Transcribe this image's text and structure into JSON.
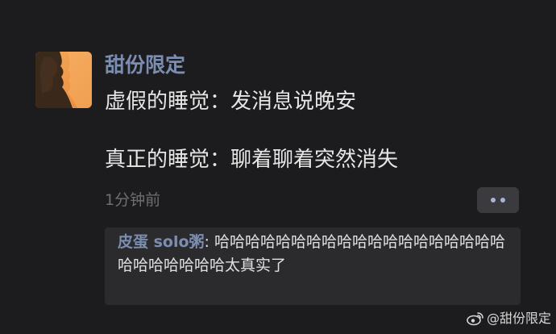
{
  "post": {
    "author": "甜份限定",
    "line1": "虚假的睡觉：发消息说晚安",
    "line2": "真正的睡觉：聊着聊着突然消失",
    "time": "1分钟前",
    "more_icon": "more-dots-icon"
  },
  "comments": [
    {
      "author": "皮蛋 solo粥",
      "separator": ": ",
      "text": "哈哈哈哈哈哈哈哈哈哈哈哈哈哈哈哈哈哈哈哈哈哈哈哈哈哈太真实了"
    }
  ],
  "watermark": {
    "text": "@甜份限定",
    "icon": "weibo-logo-icon"
  },
  "colors": {
    "background": "#1c1c1e",
    "name_accent": "#7b8db0",
    "comment_box": "#2b2b2e",
    "avatar_orange": "#f0a050"
  }
}
